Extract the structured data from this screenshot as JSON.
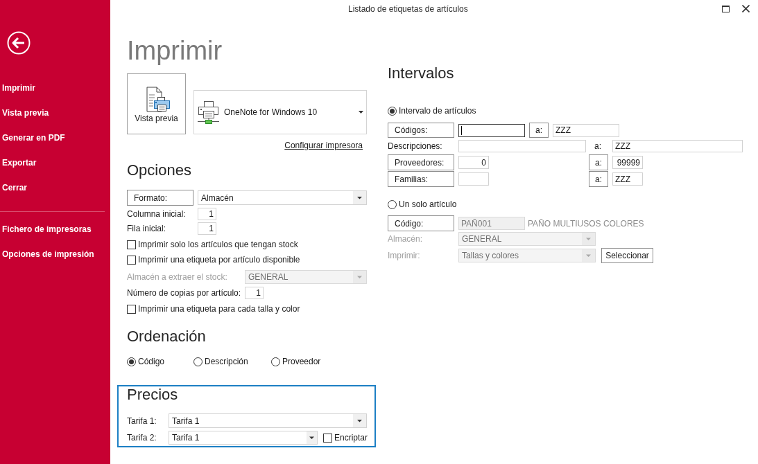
{
  "window": {
    "title": "Listado de etiquetas de artículos"
  },
  "sidebar": {
    "groups": [
      {
        "items": [
          {
            "label": "Imprimir"
          },
          {
            "label": "Vista previa"
          },
          {
            "label": "Generar en PDF"
          },
          {
            "label": "Exportar"
          },
          {
            "label": "Cerrar"
          }
        ]
      },
      {
        "items": [
          {
            "label": "Fichero de impresoras"
          },
          {
            "label": "Opciones de impresión"
          }
        ]
      }
    ]
  },
  "print": {
    "title": "Imprimir",
    "preview_button": "Vista previa",
    "printer": "OneNote for Windows 10",
    "configure_link": "Configurar impresora"
  },
  "options": {
    "heading": "Opciones",
    "format": {
      "button": "Formato:",
      "value": "Almacén"
    },
    "start_column": {
      "label": "Columna inicial:",
      "value": "1"
    },
    "start_row": {
      "label": "Fila inicial:",
      "value": "1"
    },
    "only_in_stock": {
      "label": "Imprimir solo los artículos que tengan stock",
      "checked": false
    },
    "one_per_available": {
      "label": "Imprimir una etiqueta por artículo disponible",
      "checked": false
    },
    "stock_warehouse": {
      "label": "Almacén a extraer el stock:",
      "value": "GENERAL",
      "disabled": true
    },
    "copies": {
      "label": "Número de copias por artículo:",
      "value": "1"
    },
    "one_per_size_color": {
      "label": "Imprimir una etiqueta para cada talla y color",
      "checked": false
    }
  },
  "sorting": {
    "heading": "Ordenación",
    "options": [
      {
        "label": "Código",
        "selected": true
      },
      {
        "label": "Descripción",
        "selected": false
      },
      {
        "label": "Proveedor",
        "selected": false
      }
    ]
  },
  "prices": {
    "heading": "Precios",
    "rate_1": {
      "label": "Tarifa 1:",
      "value": "Tarifa 1"
    },
    "rate_2": {
      "label": "Tarifa 2:",
      "value": "Tarifa 1"
    },
    "encrypt": {
      "label": "Encriptar",
      "checked": false
    }
  },
  "intervals": {
    "heading": "Intervalos",
    "range": {
      "label": "Intervalo de artículos",
      "selected": true
    },
    "codes": {
      "button": "Códigos:",
      "from_focused": true,
      "to_button": "a:",
      "to": "ZZZ"
    },
    "descriptions": {
      "label": "Descripciones:",
      "to_label": "a:",
      "to": "ZZZ"
    },
    "suppliers": {
      "button": "Proveedores:",
      "from": "0",
      "to_button": "a:",
      "to": "99999"
    },
    "families": {
      "button": "Familias:",
      "to_button": "a:",
      "to": "ZZZ"
    },
    "single": {
      "label": "Un solo artículo",
      "selected": false
    },
    "code": {
      "button": "Código:",
      "value": "PAÑ001",
      "description": "PAÑO MULTIUSOS COLORES",
      "disabled": true
    },
    "warehouse": {
      "label": "Almacén:",
      "value": "GENERAL",
      "disabled": true
    },
    "print_mode": {
      "label": "Imprimir:",
      "value": "Tallas y colores",
      "disabled": true
    },
    "select_button": "Seleccionar"
  }
}
